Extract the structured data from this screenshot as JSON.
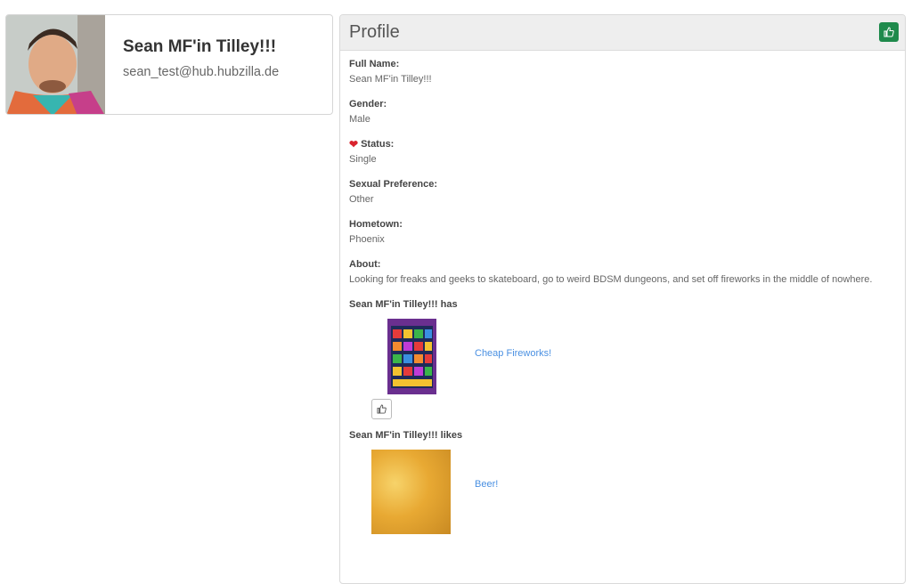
{
  "vcard": {
    "name": "Sean MF'in Tilley!!!",
    "address": "sean_test@hub.hubzilla.de"
  },
  "profile": {
    "title": "Profile",
    "like_icon": "thumbs-up-icon",
    "fields": [
      {
        "label": "Full Name:",
        "value": "Sean MF'in Tilley!!!"
      },
      {
        "label": "Gender:",
        "value": "Male"
      },
      {
        "label": "Status:",
        "value": "Single",
        "icon": "heart-icon"
      },
      {
        "label": "Sexual Preference:",
        "value": "Other"
      },
      {
        "label": "Hometown:",
        "value": "Phoenix"
      },
      {
        "label": "About:",
        "value": "Looking for freaks and geeks to skateboard, go to weird BDSM dungeons, and set off fireworks in the middle of nowhere."
      }
    ],
    "has": {
      "title": "Sean MF'in Tilley!!! has",
      "item_label": "Cheap Fireworks!"
    },
    "likes": {
      "title": "Sean MF'in Tilley!!! likes",
      "item_label": "Beer!"
    }
  },
  "colors": {
    "accent": "#1f8a4c",
    "link": "#4a90e2",
    "heart": "#d9232d"
  }
}
